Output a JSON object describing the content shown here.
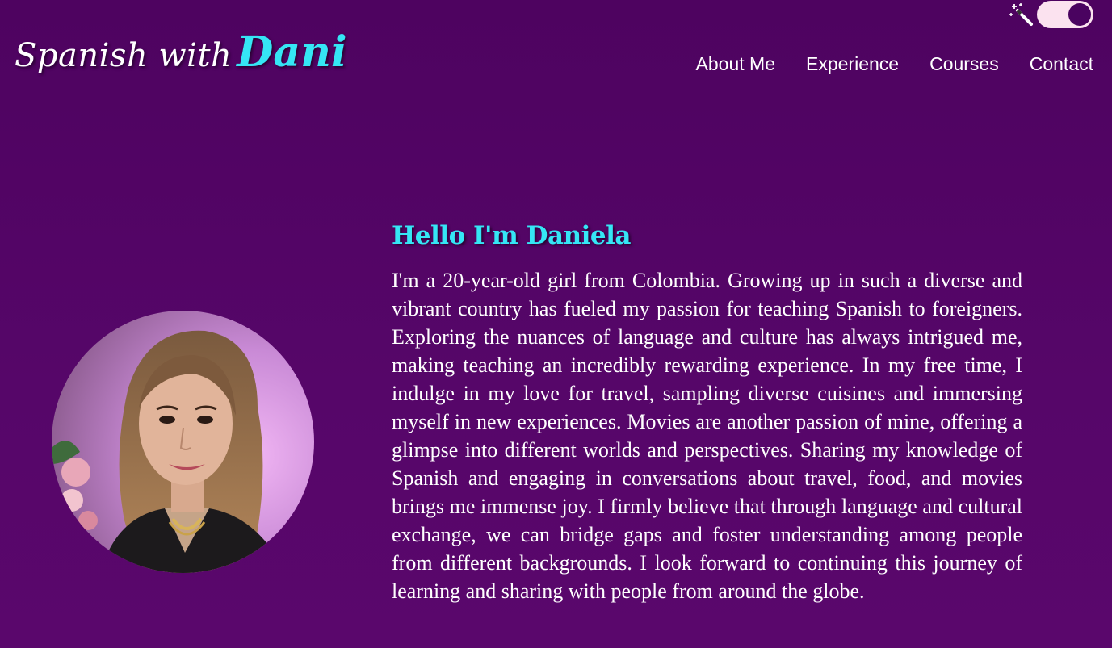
{
  "header": {
    "logo_prefix": "Spanish with",
    "logo_name": "Dani",
    "theme_toggle": {
      "icon": "magic-wand-icon",
      "state": "on"
    }
  },
  "nav": {
    "items": [
      {
        "label": "About Me"
      },
      {
        "label": "Experience"
      },
      {
        "label": "Courses"
      },
      {
        "label": "Contact"
      }
    ]
  },
  "about": {
    "heading": "Hello I'm Daniela",
    "body": "I'm a 20-year-old girl from Colombia. Growing up in such a diverse and vibrant country has fueled my passion for teaching Spanish to foreigners. Exploring the nuances of language and culture has always intrigued me, making teaching an incredibly rewarding experience. In my free time, I indulge in my love for travel, sampling diverse cuisines and immersing myself in new experiences. Movies are another passion of mine, offering a glimpse into different worlds and perspectives. Sharing my knowledge of Spanish and engaging in conversations about travel, food, and movies brings me immense joy. I firmly believe that through language and cultural exchange, we can bridge gaps and foster understanding among people from different backgrounds. I look forward to continuing this journey of learning and sharing with people from around the globe."
  },
  "colors": {
    "background": "#52046a",
    "accent": "#35e6f5",
    "toggle_track": "#fbe2ef",
    "toggle_knob": "#4a0360"
  }
}
